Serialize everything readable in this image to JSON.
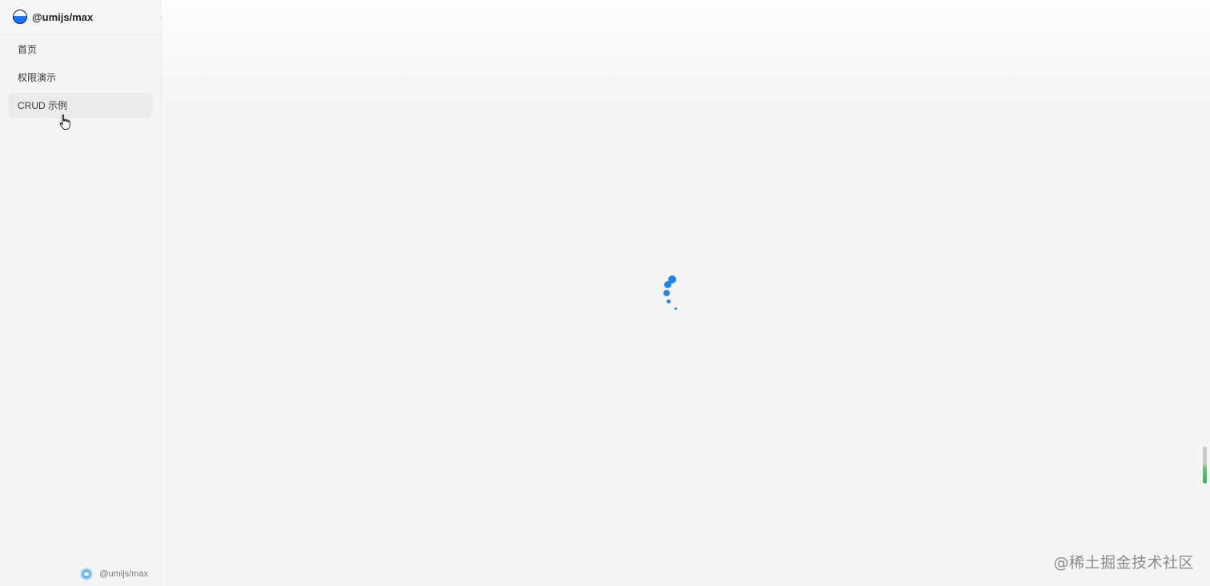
{
  "app": {
    "title": "@umijs/max"
  },
  "sidebar": {
    "collapse_icon": "chevron-left-icon",
    "items": [
      {
        "label": "首页",
        "active": false
      },
      {
        "label": "权限演示",
        "active": false
      },
      {
        "label": "CRUD 示例",
        "active": true
      }
    ],
    "footer_label": "@umijs/max"
  },
  "main": {
    "loading_indicator": "spinner-icon"
  },
  "watermark": "@稀土掘金技术社区",
  "colors": {
    "accent": "#1677ff",
    "spinner": "#1f86ef",
    "sidebar_bg": "#f5f5f5",
    "active_item_bg": "#ebebeb"
  }
}
